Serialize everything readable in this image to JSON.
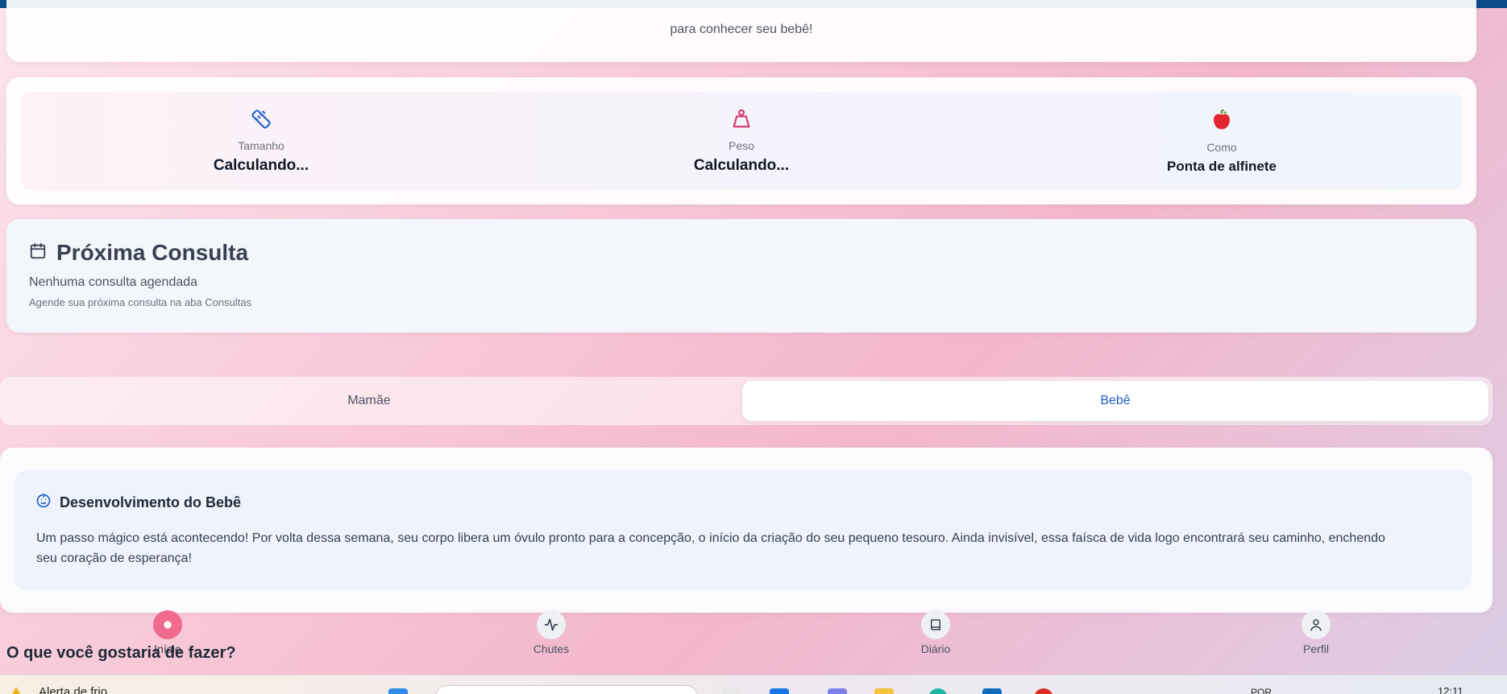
{
  "intro": {
    "faded_text": "· · · · · · · · ·",
    "line": "para conhecer seu bebê!"
  },
  "stats": [
    {
      "label": "Tamanho",
      "value": "Calculando...",
      "icon": "ruler-icon"
    },
    {
      "label": "Peso",
      "value": "Calculando...",
      "icon": "weight-icon"
    },
    {
      "label": "Como",
      "value": "Ponta de alfinete",
      "icon": "apple-icon"
    }
  ],
  "consulta": {
    "title": "Próxima Consulta",
    "subtitle": "Nenhuma consulta agendada",
    "hint": "Agende sua próxima consulta na aba Consultas"
  },
  "tabs": {
    "mamae": "Mamãe",
    "bebe": "Bebê",
    "active": "Bebê"
  },
  "development": {
    "title": "Desenvolvimento do Bebê",
    "text": "Um passo mágico está acontecendo! Por volta dessa semana, seu corpo libera um óvulo pronto para a concepção, o início da criação do seu pequeno tesouro. Ainda invisível, essa faísca de vida logo encontrará seu caminho, enchendo seu coração de esperança!"
  },
  "nav": [
    {
      "label": "Início",
      "icon": "home-icon",
      "active": true
    },
    {
      "label": "Chutes",
      "icon": "activity-icon"
    },
    {
      "label": "Diário",
      "icon": "book-icon"
    },
    {
      "label": "Perfil",
      "icon": "user-icon"
    }
  ],
  "prompt": "O que você gostaria de fazer?",
  "taskbar": {
    "alert": "Alerta de frio",
    "lang": "POR",
    "time": "12:11"
  },
  "colors": {
    "accent_blue": "#1f5ec9",
    "accent_pink": "#f06a8e",
    "top_bar": "#0b4a8b"
  }
}
